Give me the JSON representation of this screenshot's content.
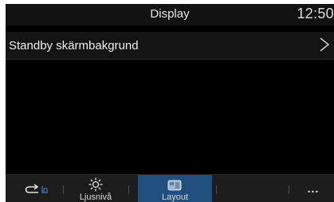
{
  "header": {
    "title": "Display",
    "clock": "12:50"
  },
  "settings_row": {
    "label": "Standby skärmbakgrund",
    "chevron_icon": "chevron-right-icon"
  },
  "toolbar": {
    "back_icon": "back-icon",
    "brightness": {
      "label": "Ljusnivå",
      "icon": "sun-icon"
    },
    "layout": {
      "label": "Layout",
      "icon": "layout-icon"
    },
    "more": {
      "label": "...",
      "icon": "more-icon"
    }
  },
  "colors": {
    "active_tab": "#1f4f7c",
    "background": "#000000"
  }
}
